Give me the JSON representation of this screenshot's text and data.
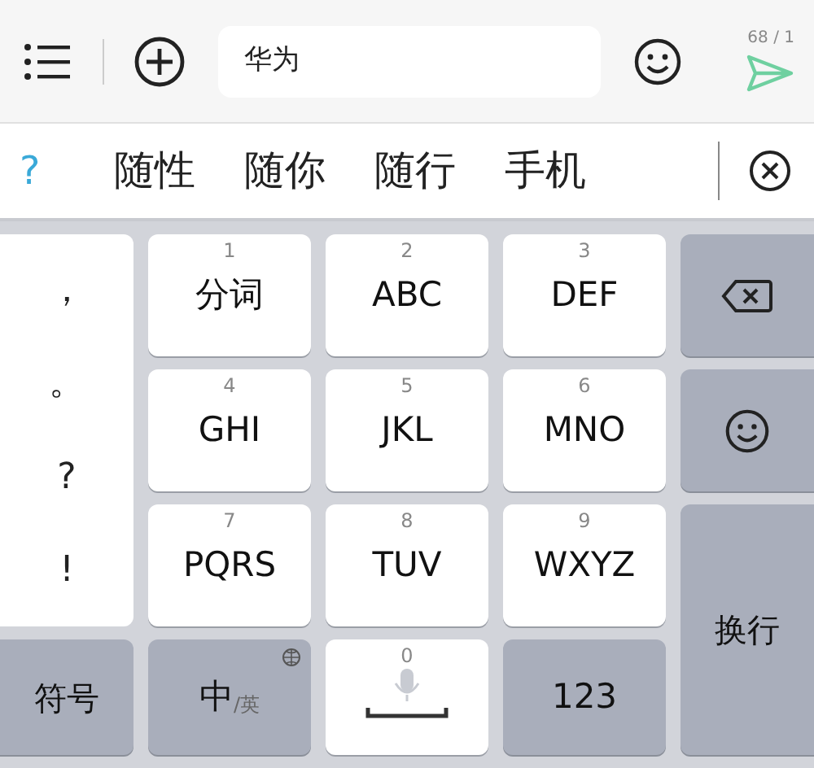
{
  "top_bar": {
    "input_value": "华为",
    "counter": "68 / 1"
  },
  "candidates": {
    "help": "?",
    "items": [
      "随性",
      "随你",
      "随行",
      "手机"
    ]
  },
  "keyboard": {
    "punctuation": [
      "，",
      "。",
      "?",
      "!"
    ],
    "digit_keys": [
      {
        "number": "1",
        "label": "分词"
      },
      {
        "number": "2",
        "label": "ABC"
      },
      {
        "number": "3",
        "label": "DEF"
      },
      {
        "number": "4",
        "label": "GHI"
      },
      {
        "number": "5",
        "label": "JKL"
      },
      {
        "number": "6",
        "label": "MNO"
      },
      {
        "number": "7",
        "label": "PQRS"
      },
      {
        "number": "8",
        "label": "TUV"
      },
      {
        "number": "9",
        "label": "WXYZ"
      }
    ],
    "enter_key": "换行",
    "symbols_key": "符号",
    "language_key": {
      "main": "中",
      "alt": "/英"
    },
    "space_key": {
      "number": "0"
    },
    "numbers_key": "123"
  }
}
